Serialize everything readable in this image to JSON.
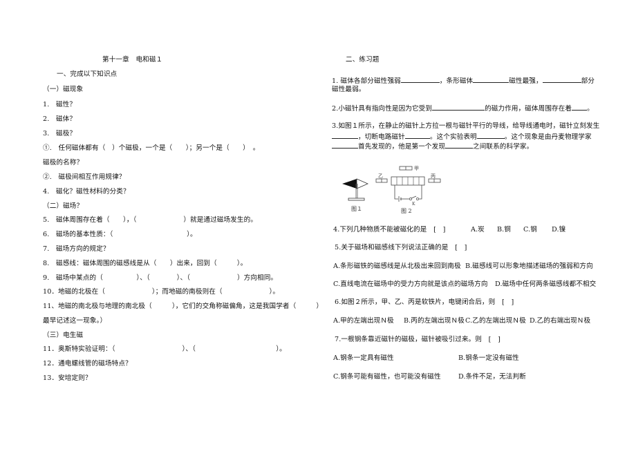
{
  "left": {
    "chapter_title": "第十一章　电和磁１",
    "section1": "一、完成以下知识点",
    "sub1": "（一）磁现象",
    "q1": "1.　磁性？",
    "q2": "2.　磁体？",
    "q3": "3.　磁极？",
    "q3_1": "①.　任何磁体都有（　）个磁极，一个是（　　）；另一个是（　　）　。",
    "q3_name": "磁极的名称？",
    "q3_2": "②.　磁极间相互作用规律？",
    "q4": "4.　磁化？磁性材料的分类？",
    "sub2": "（二）磁场？",
    "q5": "5.　磁体周围存在着（　　），（　　　　　　　）就是通过磁场发生的。",
    "q6": "6.　磁场的基本性质：（　　　　　　　　　　　）。",
    "q7": "7.　磁场方向的规定？",
    "q8": "8.　磁感线：磁体周围的磁感线是从（　　）出来，回到（　　　）。",
    "q9": "9.　磁场中某点的（　　　　　）、（　　　　）、（　　　　　　　）方向相同。",
    "q10": "10．地磁的北极在（　　　　　　　）；而地磁的南极则在（　　　　　　　）。",
    "q11a": "11、地磁的南北极与地理的南北极（　　　），它们的交角称磁偏角，这是我国学者（　　　）",
    "q11b": "最早记述这一现象。）",
    "sub3": "（三）电生磁",
    "q11c": "11．奥斯特实验证明：（　　　　　　　　　　）、（　　　　　　　　　　　　）。",
    "q12": "12．通电螺线管的磁场特点？",
    "q13": "13．安培定则？"
  },
  "right": {
    "section2": "二、练习题",
    "p1_a": "1. 磁体各部分磁性强弱",
    "p1_b": "，条形磁体",
    "p1_c": "磁性最强，",
    "p1_d": "部分",
    "p1_e": "磁性最弱。",
    "p2_a": "2.小磁针具有指向性是因为它受到",
    "p2_b": "的磁力作用，磁体周围存在着",
    "p2_c": "。",
    "p3_a": "3.如图１所示，在静止的磁针上方拉一根与磁针平行的导线，给导线通电时，磁针立刻发生",
    "p3_b": "，切断电路磁针",
    "p3_c": "。这个实验表明",
    "p3_d": "。这个现象是由丹麦物理学家",
    "p3_e": "首先发现的，他是第一个发现",
    "p3_f": "之间联系的科学家。",
    "fig1_label": "图１",
    "fig2_label": "图 2",
    "fig2_jia": "甲",
    "fig2_yi": "乙",
    "fig2_bing": "丙",
    "fig2_switch": "K",
    "p4": "4.下列几种物质不能被磁化的是　[　]",
    "p4_options": [
      "A.炭",
      "B.铜",
      "C.钢",
      "D.镍"
    ],
    "p5": "5.关于磁场和磁感线下列说法正确的是　[　]",
    "p5_a": "A.条形磁铁的磁感线是从北极出来回到南极",
    "p5_b": "B.磁感线可以形象地描述磁场的强弱和方向",
    "p5_c": "C.直线电流在磁场中的受力方向就是该点的磁场方向",
    "p5_d": "D.磁场中任何两条磁感线都不相交",
    "p6": "6.如图２所示，甲、乙、丙是软铁片，电键闭合后，则　[　]",
    "p6_a": "A.甲的左端出现Ｎ极",
    "p6_b": "B.丙的左端出现Ｎ极",
    "p6_c": "C.乙的左端出现Ｎ极",
    "p6_d": "D.乙的右端出现Ｎ极",
    "p7": "7.一根钢条靠近磁针的磁极，磁针被吸引过来。则　[　]",
    "p7_a": "A.钢条一定具有磁性",
    "p7_b": "B.钢条一定没有磁性",
    "p7_c": "C.钢条可能有磁性，也可能没有磁性",
    "p7_d": "D.条件不足，无法判断"
  }
}
